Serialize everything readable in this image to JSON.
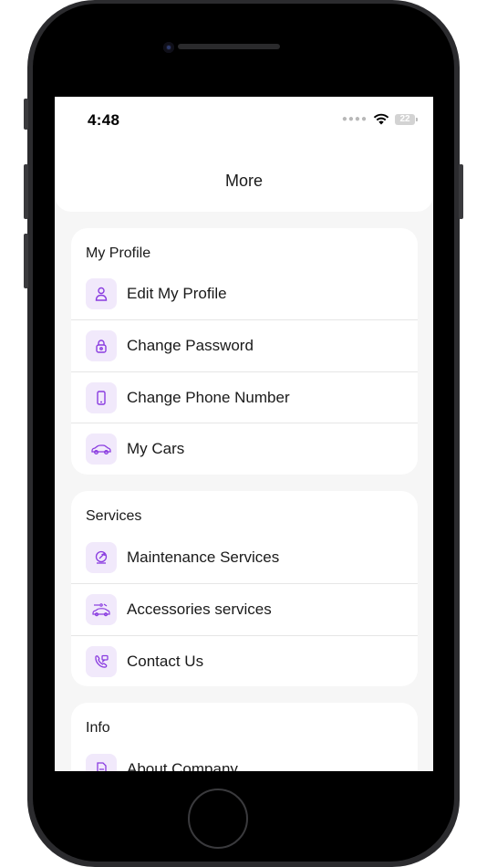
{
  "status_bar": {
    "time": "4:48",
    "battery": "22"
  },
  "header": {
    "title": "More"
  },
  "sections": [
    {
      "title": "My Profile",
      "items": [
        {
          "label": "Edit My Profile",
          "icon": "person-icon"
        },
        {
          "label": "Change Password",
          "icon": "lock-icon"
        },
        {
          "label": "Change Phone Number",
          "icon": "phone-icon"
        },
        {
          "label": "My Cars",
          "icon": "car-icon"
        }
      ]
    },
    {
      "title": "Services",
      "items": [
        {
          "label": "Maintenance Services",
          "icon": "wrench-icon"
        },
        {
          "label": "Accessories services",
          "icon": "car-accessories-icon"
        },
        {
          "label": "Contact Us",
          "icon": "phone-chat-icon"
        }
      ]
    },
    {
      "title": "Info",
      "items": [
        {
          "label": "About Company",
          "icon": "document-icon"
        }
      ]
    }
  ],
  "colors": {
    "accent": "#8a3ce0",
    "icon_bg": "#f1e9fb"
  }
}
